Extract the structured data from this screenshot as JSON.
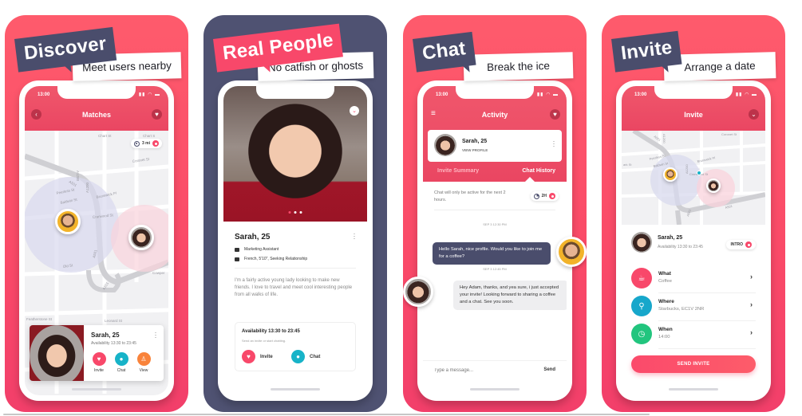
{
  "colors": {
    "brand_pink": "#f8486a",
    "navy": "#4f5272",
    "teal": "#17b3c8",
    "orange": "#f9833b",
    "green": "#22c57e"
  },
  "panels": [
    {
      "tag": "Discover",
      "subtitle": "Meet users nearby",
      "screen": {
        "status_time": "13:00",
        "status_icons": "signal wifi battery",
        "title": "Matches",
        "back_icon": "chevron-left",
        "right_icon": "heart",
        "distance": "3 mi",
        "streets": [
          "Chart St",
          "Chart St",
          "Coronet St",
          "A1200",
          "A501",
          "Peerless St",
          "Baldwin St",
          "Brunswick Pl",
          "Cranwood St",
          "A1200",
          "Old St",
          "A501",
          "A501",
          "Leonard St",
          "Featherstone St",
          "Cowper St"
        ],
        "card": {
          "name": "Sarah, 25",
          "availability": "Availability 13:30 to 23:45",
          "actions": [
            {
              "label": "Invite",
              "icon": "heart",
              "color": "#f8486a"
            },
            {
              "label": "Chat",
              "icon": "chat-bubble",
              "color": "#17b3c8"
            },
            {
              "label": "View",
              "icon": "person",
              "color": "#f9833b"
            }
          ]
        }
      }
    },
    {
      "tag": "Real People",
      "subtitle": "No catfish or ghosts",
      "screen": {
        "photo_pages": 3,
        "active_page": 1,
        "name": "Sarah, 25",
        "job": "Marketing Assistant",
        "details": "French, 5'10\", Seeking Relationship",
        "bio": "I'm a fairly active young lady looking to make new friends. I love to travel and meet cool interesting people from all walks of life.",
        "availability_title": "Availability 13:30 to 23:45",
        "availability_sub": "Send an invite or start chatting.",
        "buttons": [
          {
            "label": "Invite",
            "icon": "heart",
            "color": "#f8486a"
          },
          {
            "label": "Chat",
            "icon": "chat-bubble",
            "color": "#17b3c8"
          }
        ]
      }
    },
    {
      "tag": "Chat",
      "subtitle": "Break the ice",
      "screen": {
        "status_time": "13:00",
        "title": "Activity",
        "menu_icon": "hamburger",
        "right_icon": "heart",
        "user_name": "Sarah, 25",
        "user_link": "VIEW PROFILE",
        "tabs": [
          {
            "label": "Invite Summary",
            "active": false
          },
          {
            "label": "Chat History",
            "active": true
          }
        ],
        "note": "Chat will only be active for the next 2 hours.",
        "timer": "2H",
        "messages": [
          {
            "timestamp": "SEP 3 12:30 PM",
            "from": "me",
            "text": "Hello Sarah, nice profile. Would you like to join me for a coffee?"
          },
          {
            "timestamp": "SEP 3 12:45 PM",
            "from": "them",
            "text": "Hey Adam, thanks, and yea sure, i just accepted your invite! Looking forward to sharing a coffee and a chat. See you soon."
          }
        ],
        "composer_placeholder": "Type a message...",
        "send_label": "Send"
      }
    },
    {
      "tag": "Invite",
      "subtitle": "Arrange a date",
      "screen": {
        "status_time": "13:00",
        "title": "Invite",
        "right_icon": "chevron-down",
        "streets": [
          "Coronet St",
          "A1200",
          "A501",
          "Peerless St",
          "Baldwin St",
          "Brunswick Pl",
          "Cranwood St",
          "A501",
          "A501"
        ],
        "user_name": "Sarah, 25",
        "user_availability": "Availability 13:30 to 23:45",
        "intro_label": "INTRO",
        "rows": [
          {
            "title": "What",
            "value": "Coffee",
            "icon": "coffee-cup",
            "color": "#f8486a"
          },
          {
            "title": "Where",
            "value": "Starbucks, EC1V 2NR",
            "icon": "map-pin",
            "color": "#17a7cb"
          },
          {
            "title": "When",
            "value": "14:00",
            "icon": "clock",
            "color": "#22c57e"
          }
        ],
        "send_button": "SEND INVITE"
      }
    }
  ]
}
